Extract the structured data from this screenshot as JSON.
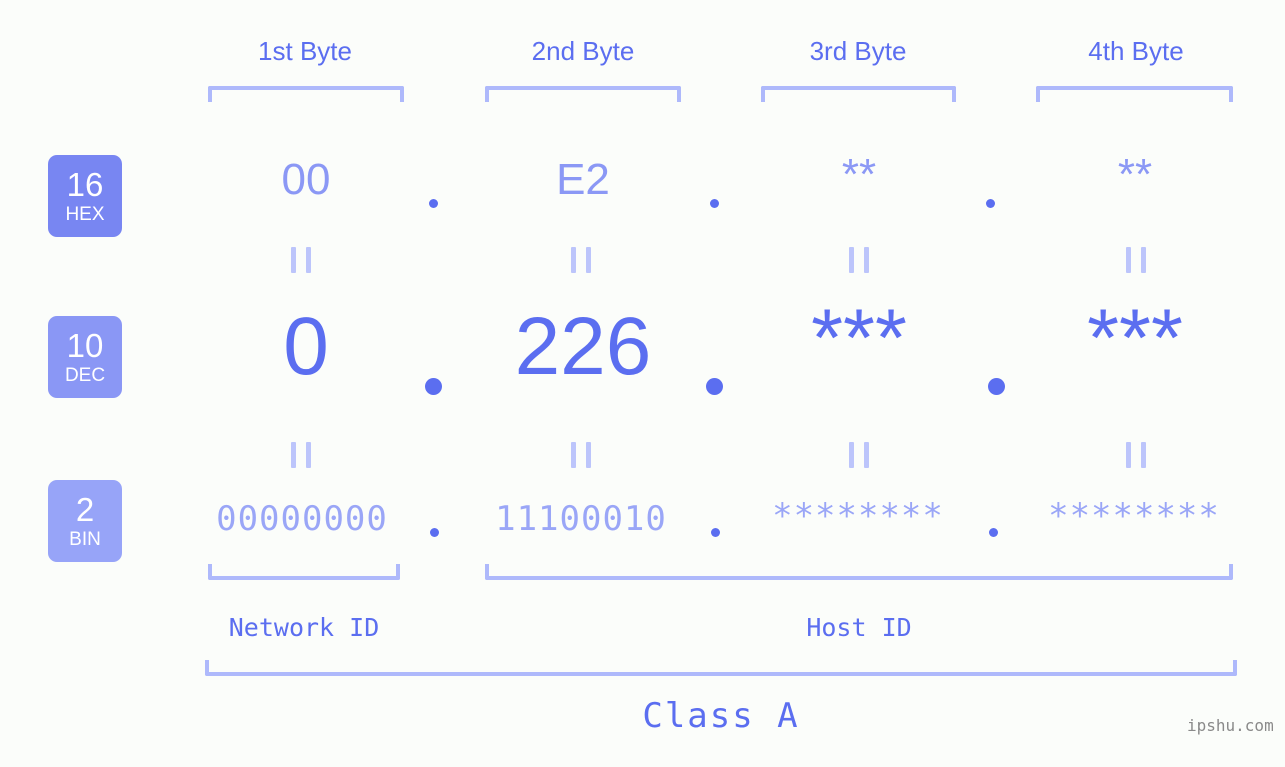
{
  "background_color": "#fbfdfa",
  "accent_color": "#5b6ef0",
  "accent_light": "#aeb9fb",
  "headers": {
    "byte1": "1st Byte",
    "byte2": "2nd Byte",
    "byte3": "3rd Byte",
    "byte4": "4th Byte"
  },
  "badges": {
    "hex": {
      "num": "16",
      "name": "HEX",
      "color": "#7886f2"
    },
    "dec": {
      "num": "10",
      "name": "DEC",
      "color": "#8a97f5"
    },
    "bin": {
      "num": "2",
      "name": "BIN",
      "color": "#97a4f8"
    }
  },
  "rows": {
    "hex": {
      "b1": "00",
      "b2": "E2",
      "b3": "**",
      "b4": "**"
    },
    "dec": {
      "b1": "0",
      "b2": "226",
      "b3": "***",
      "b4": "***"
    },
    "bin": {
      "b1": "00000000",
      "b2": "11100010",
      "b3": "********",
      "b4": "********"
    }
  },
  "separator": ".",
  "equals_mark": "=",
  "segments": {
    "network_id": "Network ID",
    "host_id": "Host ID",
    "class": "Class A"
  },
  "watermark": "ipshu.com"
}
